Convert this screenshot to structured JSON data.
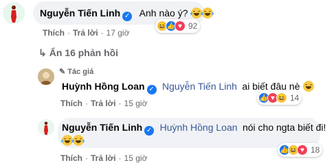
{
  "comments": [
    {
      "author": "Nguyễn Tiến Linh",
      "text": "Anh nào ý?",
      "actions": {
        "like": "Thích",
        "reply": "Trả lời",
        "time": "17 giờ"
      },
      "reactions": {
        "icons": [
          "haha-icon",
          "like-icon",
          "love-icon"
        ],
        "count": "92"
      }
    }
  ],
  "more_replies": "Ẩn 16 phản hồi",
  "replies": [
    {
      "author_tag": "Tác giả",
      "author": "Huỳnh Hồng Loan",
      "mention": "Nguyễn Tiến Linh",
      "text": "ai biết đâu nè",
      "actions": {
        "like": "Thích",
        "reply": "Trả lời",
        "time": "15 giờ"
      },
      "reactions": {
        "icons": [
          "like-icon",
          "love-icon",
          "haha-icon"
        ],
        "count": "14"
      }
    },
    {
      "author": "Nguyễn Tiến Linh",
      "mention": "Huỳnh Hồng Loan",
      "text": "nói cho ngta biết đi!",
      "actions": {
        "like": "Thích",
        "reply": "Trả lời",
        "time": "15 giờ"
      },
      "reactions": {
        "icons": [
          "like-icon",
          "haha-icon",
          "love-icon"
        ],
        "count": "18"
      }
    }
  ],
  "colors": {
    "bubble": "#f0f2f5",
    "link": "#385898",
    "meta": "#65676b",
    "verified": "#1877f2"
  }
}
